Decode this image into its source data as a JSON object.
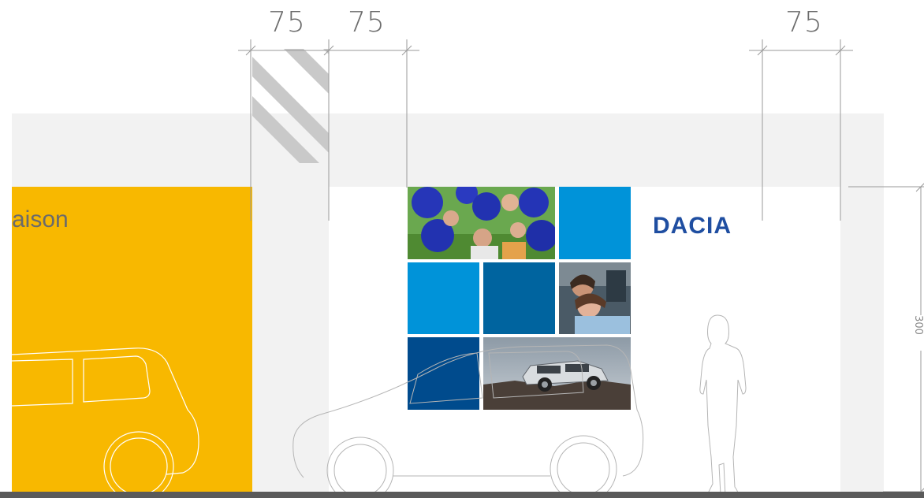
{
  "dimensions": {
    "top_labels": [
      "75",
      "75",
      "75"
    ],
    "height_label": "300"
  },
  "panel": {
    "yellow_text": "aison"
  },
  "brand": {
    "logo_text": "DACIA",
    "colors": {
      "yellow": "#f8b800",
      "light_blue": "#0093d9",
      "mid_blue": "#00649f",
      "dark_blue": "#004b8d",
      "logo_blue": "#1f4ea1",
      "wall_grey": "#f2f2f2",
      "floor": "#5a5a5a"
    }
  },
  "mosaic": {
    "tiles": [
      {
        "name": "photo-balloons-tile",
        "kind": "photo-balloons"
      },
      {
        "name": "light-blue-tile-top",
        "kind": "color",
        "color": "light_blue"
      },
      {
        "name": "light-blue-tile-middle",
        "kind": "color",
        "color": "light_blue"
      },
      {
        "name": "mid-blue-tile",
        "kind": "color",
        "color": "mid_blue"
      },
      {
        "name": "photo-couple-tile",
        "kind": "photo-couple"
      },
      {
        "name": "dark-blue-tile",
        "kind": "color",
        "color": "dark_blue"
      },
      {
        "name": "photo-car-tile",
        "kind": "photo-car"
      }
    ]
  },
  "icons": [
    "hatch-stripes-icon",
    "car-outline-icon",
    "person-silhouette-icon",
    "dimension-line-icon"
  ]
}
